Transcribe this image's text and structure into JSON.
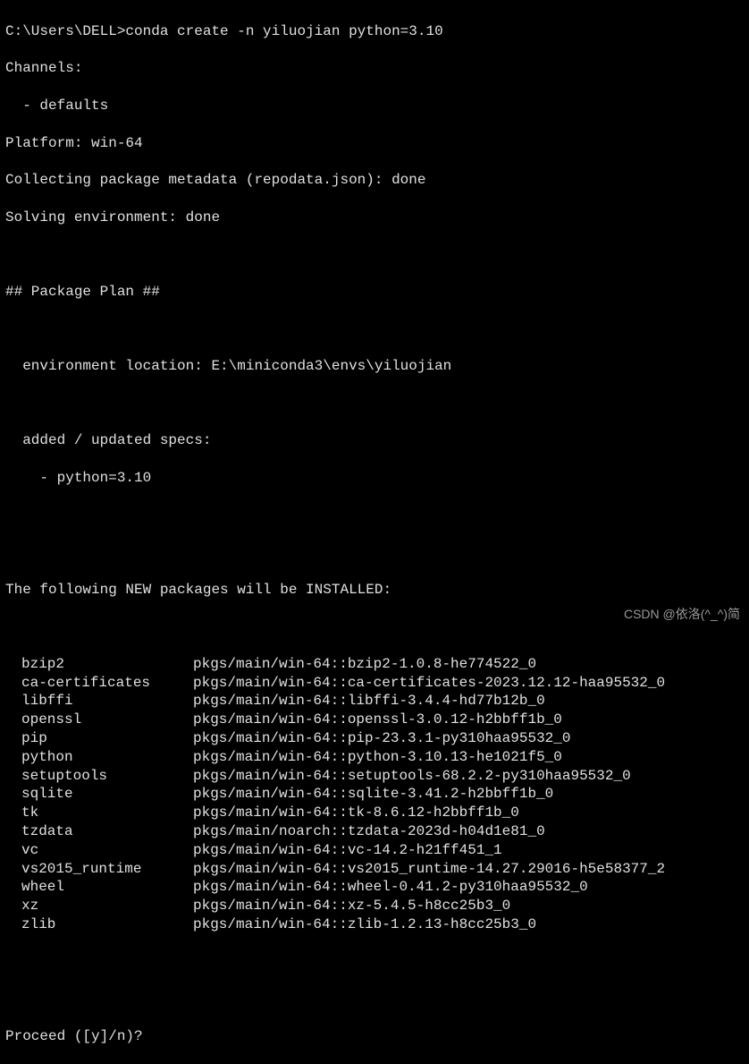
{
  "prompt": {
    "path": "C:\\Users\\DELL>",
    "command": "conda create -n yiluojian python=3.10"
  },
  "lines": {
    "channels_header": "Channels:",
    "channels_item": "  - defaults",
    "platform": "Platform: win-64",
    "collecting": "Collecting package metadata (repodata.json): done",
    "solving": "Solving environment: done",
    "plan_header": "## Package Plan ##",
    "env_location": "  environment location: E:\\miniconda3\\envs\\yiluojian",
    "added_specs_header": "  added / updated specs:",
    "added_specs_item": "    - python=3.10",
    "new_packages_header": "The following NEW packages will be INSTALLED:",
    "proceed": "Proceed ([y]/n)?"
  },
  "packages": [
    {
      "name": "bzip2",
      "spec": "pkgs/main/win-64::bzip2-1.0.8-he774522_0"
    },
    {
      "name": "ca-certificates",
      "spec": "pkgs/main/win-64::ca-certificates-2023.12.12-haa95532_0"
    },
    {
      "name": "libffi",
      "spec": "pkgs/main/win-64::libffi-3.4.4-hd77b12b_0"
    },
    {
      "name": "openssl",
      "spec": "pkgs/main/win-64::openssl-3.0.12-h2bbff1b_0"
    },
    {
      "name": "pip",
      "spec": "pkgs/main/win-64::pip-23.3.1-py310haa95532_0"
    },
    {
      "name": "python",
      "spec": "pkgs/main/win-64::python-3.10.13-he1021f5_0"
    },
    {
      "name": "setuptools",
      "spec": "pkgs/main/win-64::setuptools-68.2.2-py310haa95532_0"
    },
    {
      "name": "sqlite",
      "spec": "pkgs/main/win-64::sqlite-3.41.2-h2bbff1b_0"
    },
    {
      "name": "tk",
      "spec": "pkgs/main/win-64::tk-8.6.12-h2bbff1b_0"
    },
    {
      "name": "tzdata",
      "spec": "pkgs/main/noarch::tzdata-2023d-h04d1e81_0"
    },
    {
      "name": "vc",
      "spec": "pkgs/main/win-64::vc-14.2-h21ff451_1"
    },
    {
      "name": "vs2015_runtime",
      "spec": "pkgs/main/win-64::vs2015_runtime-14.27.29016-h5e58377_2"
    },
    {
      "name": "wheel",
      "spec": "pkgs/main/win-64::wheel-0.41.2-py310haa95532_0"
    },
    {
      "name": "xz",
      "spec": "pkgs/main/win-64::xz-5.4.5-h8cc25b3_0"
    },
    {
      "name": "zlib",
      "spec": "pkgs/main/win-64::zlib-1.2.13-h8cc25b3_0"
    }
  ],
  "watermark": "CSDN @依洛(^_^)简"
}
